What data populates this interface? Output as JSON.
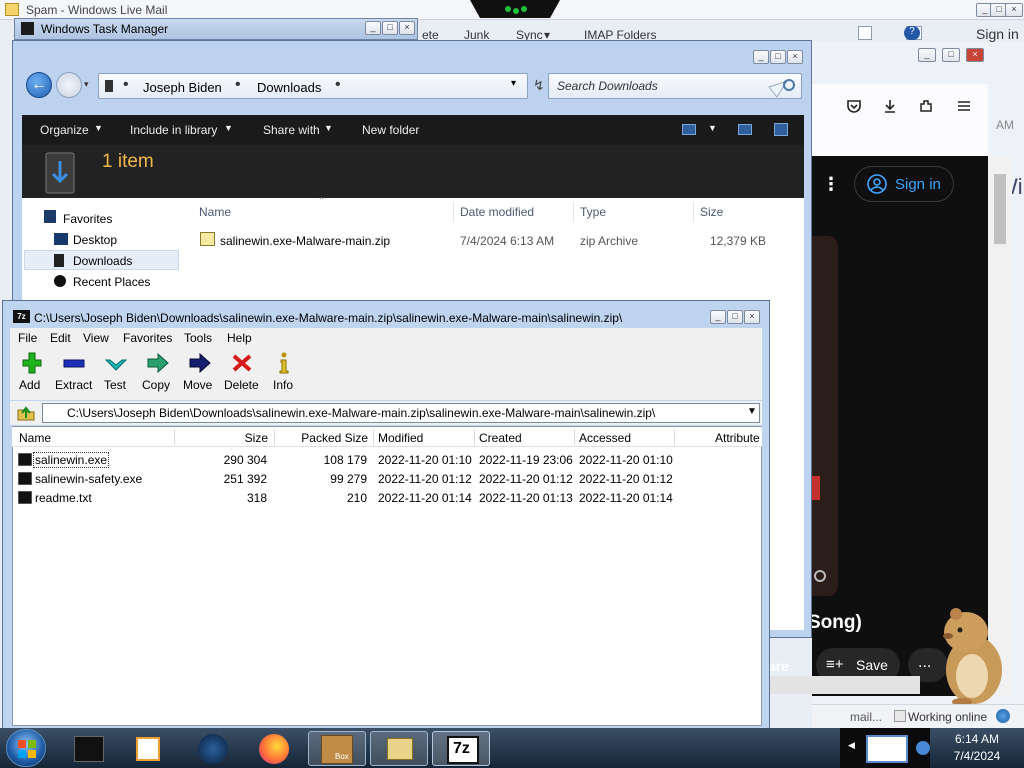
{
  "livemail": {
    "title": "Spam - Windows Live Mail",
    "toolbar": [
      "ete",
      "Junk",
      "Sync",
      "IMAP Folders"
    ]
  },
  "taskmgr": {
    "title": "Windows Task Manager"
  },
  "browser": {
    "signin": "Sign in",
    "title_fragment": "Song)",
    "share_fragment": "are",
    "save": "Save",
    "more": "...",
    "side_text": "Wi",
    "am_text": "AM",
    "status_left": "mail...",
    "status_right": "Working online"
  },
  "explorer": {
    "breadcrumb": [
      "Joseph Biden",
      "Downloads"
    ],
    "search_placeholder": "Search Downloads",
    "commands": [
      "Organize",
      "Include in library",
      "Share with",
      "New folder"
    ],
    "item_count": "1 item",
    "nav": [
      "Favorites",
      "Desktop",
      "Downloads",
      "Recent Places"
    ],
    "columns": [
      "Name",
      "Date modified",
      "Type",
      "Size"
    ],
    "files": [
      {
        "name": "salinewin.exe-Malware-main.zip",
        "modified": "7/4/2024 6:13 AM",
        "type": "zip Archive",
        "size": "12,379 KB"
      }
    ]
  },
  "sevenzip": {
    "title": "C:\\Users\\Joseph Biden\\Downloads\\salinewin.exe-Malware-main.zip\\salinewin.exe-Malware-main\\salinewin.zip\\",
    "menu": [
      "File",
      "Edit",
      "View",
      "Favorites",
      "Tools",
      "Help"
    ],
    "toolbar": [
      "Add",
      "Extract",
      "Test",
      "Copy",
      "Move",
      "Delete",
      "Info"
    ],
    "path": "C:\\Users\\Joseph Biden\\Downloads\\salinewin.exe-Malware-main.zip\\salinewin.exe-Malware-main\\salinewin.zip\\",
    "columns": [
      "Name",
      "Size",
      "Packed Size",
      "Modified",
      "Created",
      "Accessed",
      "Attributes"
    ],
    "files": [
      {
        "name": "salinewin.exe",
        "size": "290 304",
        "packed": "108 179",
        "modified": "2022-11-20 01:10",
        "created": "2022-11-19 23:06",
        "accessed": "2022-11-20 01:10"
      },
      {
        "name": "salinewin-safety.exe",
        "size": "251 392",
        "packed": "99 279",
        "modified": "2022-11-20 01:12",
        "created": "2022-11-20 01:12",
        "accessed": "2022-11-20 01:12"
      },
      {
        "name": "readme.txt",
        "size": "318",
        "packed": "210",
        "modified": "2022-11-20 01:14",
        "created": "2022-11-20 01:13",
        "accessed": "2022-11-20 01:14"
      }
    ]
  },
  "taskbar": {
    "time": "6:14 AM",
    "date": "7/4/2024",
    "box_label": "Box",
    "sevenzip_label": "7z"
  }
}
